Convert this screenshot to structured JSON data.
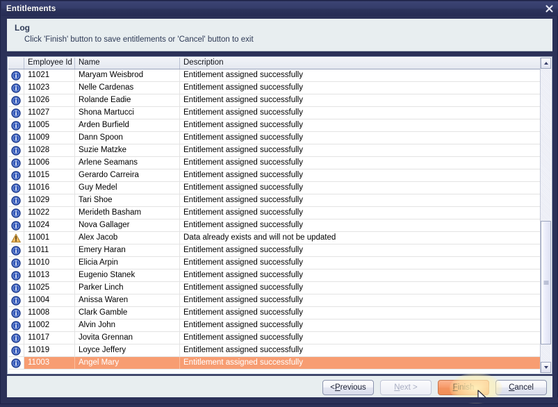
{
  "window": {
    "title": "Entitlements",
    "close_icon": "close-icon"
  },
  "header": {
    "title": "Log",
    "subtitle": "Click 'Finish' button to save entitlements or 'Cancel' button to exit"
  },
  "table": {
    "columns": [
      "",
      "Employee Id",
      "Name",
      "Description"
    ],
    "rows": [
      {
        "icon": "info-icon",
        "id": "11021",
        "name": "Maryam Weisbrod",
        "description": "Entitlement assigned successfully",
        "selected": false
      },
      {
        "icon": "info-icon",
        "id": "11023",
        "name": "Nelle Cardenas",
        "description": "Entitlement assigned successfully",
        "selected": false
      },
      {
        "icon": "info-icon",
        "id": "11026",
        "name": "Rolande Eadie",
        "description": "Entitlement assigned successfully",
        "selected": false
      },
      {
        "icon": "info-icon",
        "id": "11027",
        "name": "Shona Martucci",
        "description": "Entitlement assigned successfully",
        "selected": false
      },
      {
        "icon": "info-icon",
        "id": "11005",
        "name": "Arden Burfield",
        "description": "Entitlement assigned successfully",
        "selected": false
      },
      {
        "icon": "info-icon",
        "id": "11009",
        "name": "Dann Spoon",
        "description": "Entitlement assigned successfully",
        "selected": false
      },
      {
        "icon": "info-icon",
        "id": "11028",
        "name": "Suzie Matzke",
        "description": "Entitlement assigned successfully",
        "selected": false
      },
      {
        "icon": "info-icon",
        "id": "11006",
        "name": "Arlene Seamans",
        "description": "Entitlement assigned successfully",
        "selected": false
      },
      {
        "icon": "info-icon",
        "id": "11015",
        "name": "Gerardo Carreira",
        "description": "Entitlement assigned successfully",
        "selected": false
      },
      {
        "icon": "info-icon",
        "id": "11016",
        "name": "Guy Medel",
        "description": "Entitlement assigned successfully",
        "selected": false
      },
      {
        "icon": "info-icon",
        "id": "11029",
        "name": "Tari Shoe",
        "description": "Entitlement assigned successfully",
        "selected": false
      },
      {
        "icon": "info-icon",
        "id": "11022",
        "name": "Merideth Basham",
        "description": "Entitlement assigned successfully",
        "selected": false
      },
      {
        "icon": "info-icon",
        "id": "11024",
        "name": "Nova Gallager",
        "description": "Entitlement assigned successfully",
        "selected": false
      },
      {
        "icon": "warning-icon",
        "id": "11001",
        "name": "Alex Jacob",
        "description": "Data already exists and will not be updated",
        "selected": false
      },
      {
        "icon": "info-icon",
        "id": "11011",
        "name": "Emery Haran",
        "description": "Entitlement assigned successfully",
        "selected": false
      },
      {
        "icon": "info-icon",
        "id": "11010",
        "name": "Elicia Arpin",
        "description": "Entitlement assigned successfully",
        "selected": false
      },
      {
        "icon": "info-icon",
        "id": "11013",
        "name": "Eugenio Stanek",
        "description": "Entitlement assigned successfully",
        "selected": false
      },
      {
        "icon": "info-icon",
        "id": "11025",
        "name": "Parker Linch",
        "description": "Entitlement assigned successfully",
        "selected": false
      },
      {
        "icon": "info-icon",
        "id": "11004",
        "name": "Anissa Waren",
        "description": "Entitlement assigned successfully",
        "selected": false
      },
      {
        "icon": "info-icon",
        "id": "11008",
        "name": "Clark Gamble",
        "description": "Entitlement assigned successfully",
        "selected": false
      },
      {
        "icon": "info-icon",
        "id": "11002",
        "name": "Alvin John",
        "description": "Entitlement assigned successfully",
        "selected": false
      },
      {
        "icon": "info-icon",
        "id": "11017",
        "name": "Jovita Grennan",
        "description": "Entitlement assigned successfully",
        "selected": false
      },
      {
        "icon": "info-icon",
        "id": "11019",
        "name": "Loyce Jeffery",
        "description": "Entitlement assigned successfully",
        "selected": false
      },
      {
        "icon": "info-icon",
        "id": "11003",
        "name": "Angel Mary",
        "description": "Entitlement assigned successfully",
        "selected": true
      }
    ]
  },
  "scrollbar": {
    "up_icon": "scroll-up-arrow-icon",
    "down_icon": "scroll-down-arrow-icon",
    "thumb_top_pct": 52,
    "thumb_height_pct": 42
  },
  "footer": {
    "buttons": [
      {
        "name": "previous-button",
        "label": "< Previous",
        "state": "enabled"
      },
      {
        "name": "next-button",
        "label": "Next >",
        "state": "disabled"
      },
      {
        "name": "finish-button",
        "label": "Finish",
        "state": "primary-hover"
      },
      {
        "name": "cancel-button",
        "label": "Cancel",
        "state": "enabled"
      }
    ]
  },
  "colors": {
    "titlebar": "#343c6a",
    "panel": "#e8eef0",
    "selection": "#f79d72",
    "info": "#2f56b5",
    "warning": "#e8a33d",
    "primary_button": "#f79c6d"
  }
}
